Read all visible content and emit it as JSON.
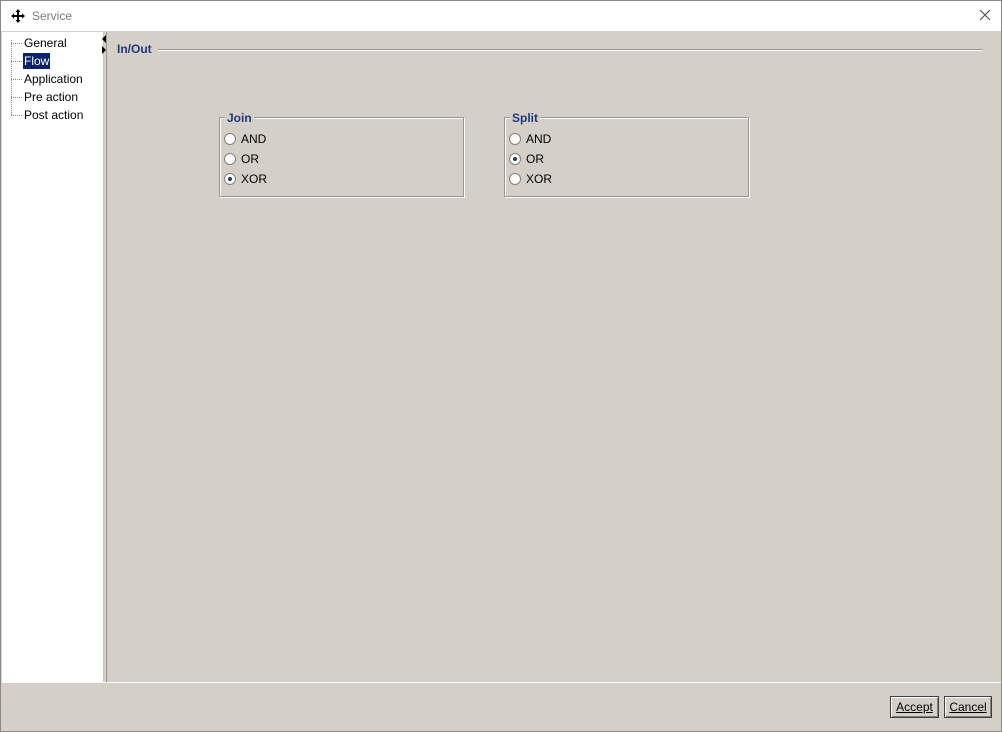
{
  "window": {
    "title": "Service",
    "icon": "move-cross-icon",
    "close_icon": "close-icon"
  },
  "tree": {
    "items": [
      {
        "label": "General",
        "selected": false
      },
      {
        "label": "Flow",
        "selected": true
      },
      {
        "label": "Application",
        "selected": false
      },
      {
        "label": "Pre action",
        "selected": false
      },
      {
        "label": "Post action",
        "selected": false
      }
    ]
  },
  "content": {
    "section_title": "In/Out",
    "join": {
      "legend": "Join",
      "options": [
        "AND",
        "OR",
        "XOR"
      ],
      "selected": "XOR"
    },
    "split": {
      "legend": "Split",
      "options": [
        "AND",
        "OR",
        "XOR"
      ],
      "selected": "OR"
    }
  },
  "buttons": {
    "accept": "Accept",
    "cancel": "Cancel"
  },
  "colors": {
    "background": "#d4d0c8",
    "accent": "#1f3a7a",
    "selection": "#0a246a"
  }
}
